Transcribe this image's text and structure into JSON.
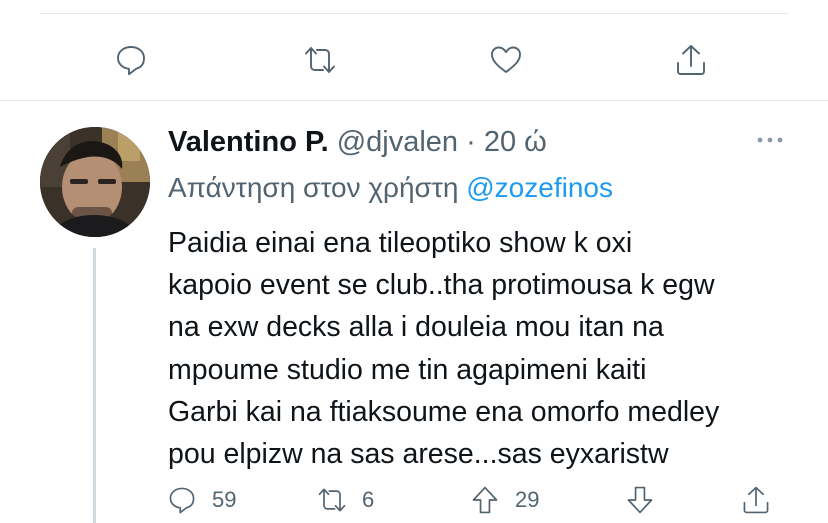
{
  "top_actions": {
    "reply_icon": "reply-icon",
    "retweet_icon": "retweet-icon",
    "like_icon": "heart-icon",
    "share_icon": "share-icon"
  },
  "tweet": {
    "author_name": "Valentino P.",
    "handle": "@djvalen",
    "separator": "·",
    "time": "20 ώ",
    "reply_prefix": "Απάντηση στον χρήστη",
    "reply_to": "@zozefinos",
    "text": "Paidia einai ena tileoptiko show k oxi\nkapoio event se club..tha protimousa k egw\nna exw decks alla i douleia mou itan na\nmpoume studio me tin agapimeni kaiti\nGarbi kai na ftiaksoume ena omorfo medley\npou elpizw na sas arese...sas eyxaristw",
    "actions": {
      "reply_count": "59",
      "retweet_count": "6",
      "upvote_count": "29"
    }
  },
  "colors": {
    "accent": "#1d9bf0",
    "secondary_text": "#536471",
    "divider": "#e6e9ec"
  }
}
